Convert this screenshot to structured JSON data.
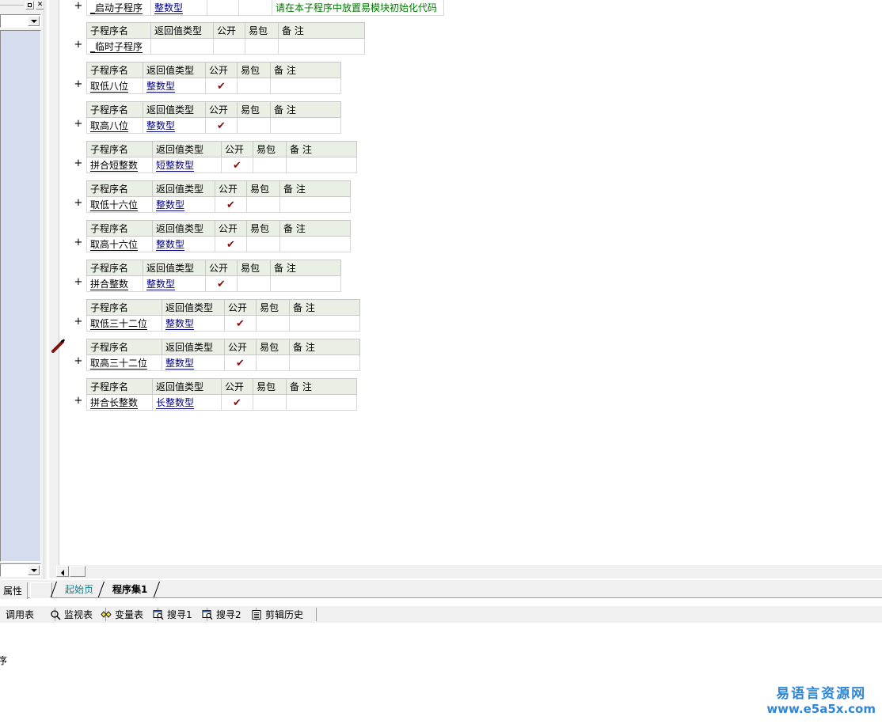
{
  "window": {
    "maximize_glyph": "□",
    "close_glyph": "✕"
  },
  "left_panel": {
    "combo_value": "",
    "tab_label": "属性"
  },
  "editor": {
    "columns": [
      "子程序名",
      "返回值类型",
      "公开",
      "易包",
      "备 注"
    ],
    "expander_glyph": "+",
    "check_glyph": "✔",
    "first_row": {
      "name": "_启动子程序",
      "rettype": "整数型",
      "public": "",
      "package": "",
      "note": "请在本子程序中放置易模块初始化代码"
    },
    "procedures": [
      {
        "name": "_临时子程序",
        "rettype": "",
        "public": "",
        "package": "",
        "note": "",
        "col_name_w": 72,
        "col_ret_w": 70
      },
      {
        "name": "取低八位",
        "rettype": "整数型",
        "public": "✔",
        "package": "",
        "note": "",
        "col_name_w": 62,
        "col_ret_w": 70
      },
      {
        "name": "取高八位",
        "rettype": "整数型",
        "public": "✔",
        "package": "",
        "note": "",
        "col_name_w": 62,
        "col_ret_w": 70
      },
      {
        "name": "拼合短整数",
        "rettype": "短整数型",
        "public": "✔",
        "package": "",
        "note": "",
        "col_name_w": 74,
        "col_ret_w": 78
      },
      {
        "name": "取低十六位",
        "rettype": "整数型",
        "public": "✔",
        "package": "",
        "note": "",
        "col_name_w": 74,
        "col_ret_w": 70
      },
      {
        "name": "取高十六位",
        "rettype": "整数型",
        "public": "✔",
        "package": "",
        "note": "",
        "col_name_w": 74,
        "col_ret_w": 70
      },
      {
        "name": "拼合整数",
        "rettype": "整数型",
        "public": "✔",
        "package": "",
        "note": "",
        "col_name_w": 62,
        "col_ret_w": 70
      },
      {
        "name": "取低三十二位",
        "rettype": "整数型",
        "public": "✔",
        "package": "",
        "note": "",
        "col_name_w": 86,
        "col_ret_w": 70
      },
      {
        "name": "取高三十二位",
        "rettype": "整数型",
        "public": "✔",
        "package": "",
        "note": "",
        "col_name_w": 86,
        "col_ret_w": 70
      },
      {
        "name": "拼合长整数",
        "rettype": "长整数型",
        "public": "✔",
        "package": "",
        "note": "",
        "col_name_w": 74,
        "col_ret_w": 78
      }
    ],
    "modified_marker_icon": "pencil-icon"
  },
  "tabs": {
    "items": [
      {
        "label": "起始页",
        "active": false
      },
      {
        "label": "程序集1",
        "active": true
      }
    ]
  },
  "bottom_tools": [
    {
      "label": "调用表",
      "icon": ""
    },
    {
      "label": "监视表",
      "icon": "magnifier-icon"
    },
    {
      "label": "变量表",
      "icon": "diamonds-icon"
    },
    {
      "label": "搜寻1",
      "icon": "find-window-icon"
    },
    {
      "label": "搜寻2",
      "icon": "find-window-icon"
    },
    {
      "label": "剪辑历史",
      "icon": "clipboard-icon"
    }
  ],
  "lower_pane": {
    "text": "序"
  },
  "watermark": {
    "cn": "易语言资源网",
    "url": "www.e5a5x.com"
  },
  "colors": {
    "header_bg": "#eaefe6",
    "link": "#00007f",
    "check": "#7b1313",
    "note": "#007700",
    "tab_inactive": "#11818f",
    "watermark": "#2f86d6",
    "panel_bg": "#f0f0f0",
    "list_bg": "#d5dced"
  }
}
